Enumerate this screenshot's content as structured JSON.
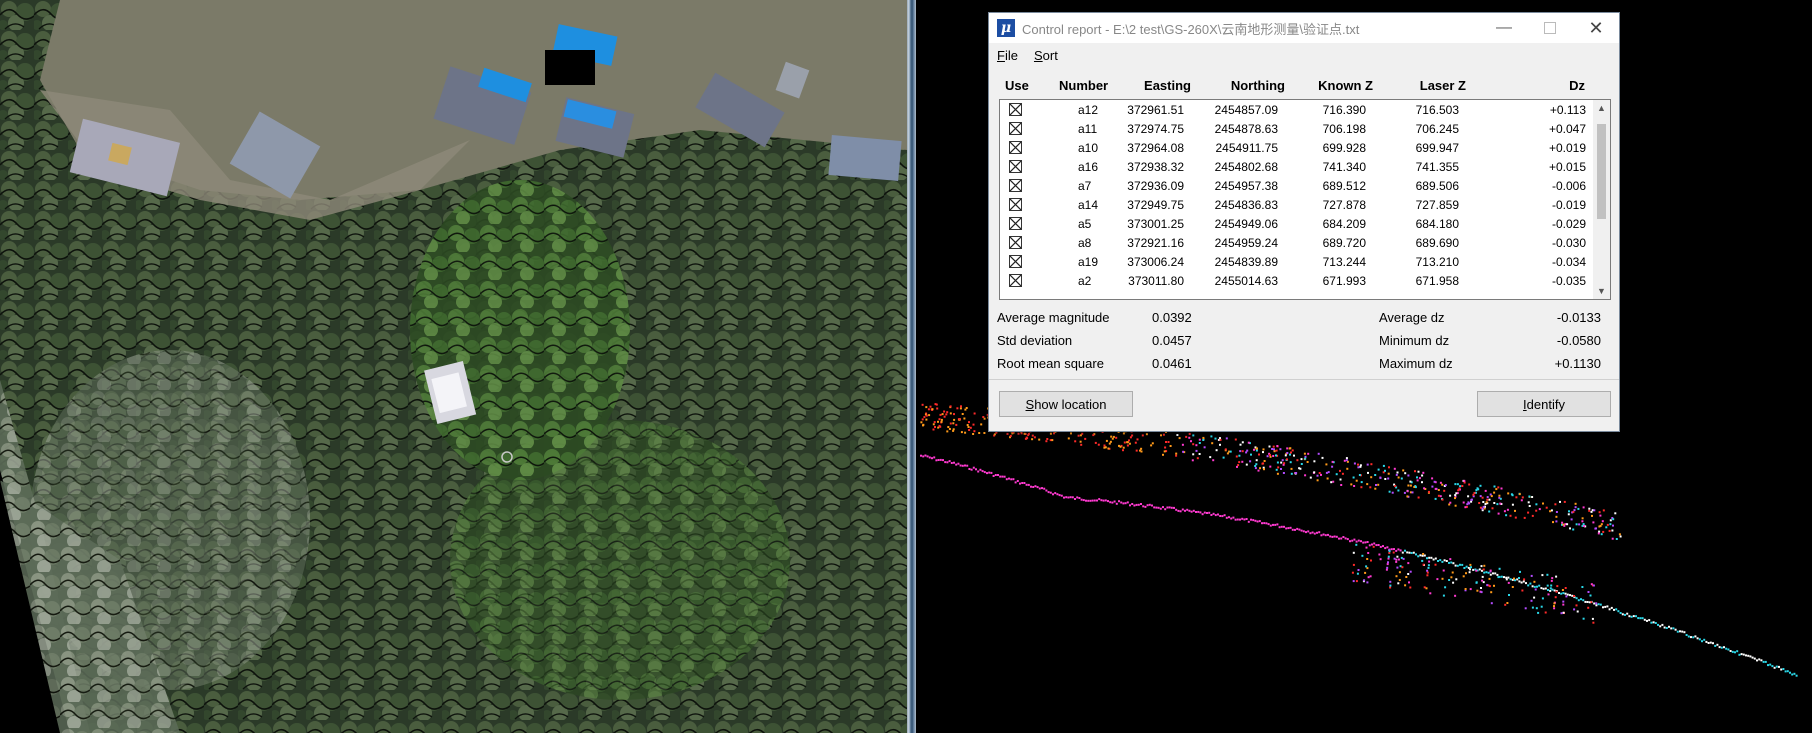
{
  "dialog": {
    "title": "Control report - E:\\2 test\\GS-260X\\云南地形测量\\验证点.txt",
    "app_icon_glyph": "μ",
    "menu": [
      {
        "label": "File",
        "hotkey": "F",
        "rest": "ile"
      },
      {
        "label": "Sort",
        "hotkey": "S",
        "rest": "ort"
      }
    ],
    "columns": {
      "use": "Use",
      "number": "Number",
      "easting": "Easting",
      "northing": "Northing",
      "known_z": "Known Z",
      "laser_z": "Laser Z",
      "dz": "Dz"
    },
    "rows": [
      {
        "number": "a12",
        "easting": "372961.51",
        "northing": "2454857.09",
        "known_z": "716.390",
        "laser_z": "716.503",
        "dz": "+0.113",
        "use": true
      },
      {
        "number": "a11",
        "easting": "372974.75",
        "northing": "2454878.63",
        "known_z": "706.198",
        "laser_z": "706.245",
        "dz": "+0.047",
        "use": true
      },
      {
        "number": "a10",
        "easting": "372964.08",
        "northing": "2454911.75",
        "known_z": "699.928",
        "laser_z": "699.947",
        "dz": "+0.019",
        "use": true
      },
      {
        "number": "a16",
        "easting": "372938.32",
        "northing": "2454802.68",
        "known_z": "741.340",
        "laser_z": "741.355",
        "dz": "+0.015",
        "use": true
      },
      {
        "number": "a7",
        "easting": "372936.09",
        "northing": "2454957.38",
        "known_z": "689.512",
        "laser_z": "689.506",
        "dz": "-0.006",
        "use": true
      },
      {
        "number": "a14",
        "easting": "372949.75",
        "northing": "2454836.83",
        "known_z": "727.878",
        "laser_z": "727.859",
        "dz": "-0.019",
        "use": true
      },
      {
        "number": "a5",
        "easting": "373001.25",
        "northing": "2454949.06",
        "known_z": "684.209",
        "laser_z": "684.180",
        "dz": "-0.029",
        "use": true
      },
      {
        "number": "a8",
        "easting": "372921.16",
        "northing": "2454959.24",
        "known_z": "689.720",
        "laser_z": "689.690",
        "dz": "-0.030",
        "use": true
      },
      {
        "number": "a19",
        "easting": "373006.24",
        "northing": "2454839.89",
        "known_z": "713.244",
        "laser_z": "713.210",
        "dz": "-0.034",
        "use": true
      },
      {
        "number": "a2",
        "easting": "373011.80",
        "northing": "2455014.63",
        "known_z": "671.993",
        "laser_z": "671.958",
        "dz": "-0.035",
        "use": true
      }
    ],
    "stats": {
      "average_magnitude_label": "Average magnitude",
      "average_magnitude": "0.0392",
      "std_deviation_label": "Std deviation",
      "std_deviation": "0.0457",
      "rms_label": "Root mean square",
      "rms": "0.0461",
      "average_dz_label": "Average dz",
      "average_dz": "-0.0133",
      "minimum_dz_label": "Minimum dz",
      "minimum_dz": "-0.0580",
      "maximum_dz_label": "Maximum dz",
      "maximum_dz": "+0.1130"
    },
    "buttons": {
      "show_location": {
        "hotkey": "S",
        "rest": "how location"
      },
      "identify": {
        "hotkey": "I",
        "rest": "dentify"
      }
    }
  },
  "colors": {
    "titlebar_bg": "#ffffff",
    "dialog_bg": "#f0f0f0",
    "app_icon": "#1d4ea3",
    "profile_points": [
      "#ff2a2a",
      "#ff3ad0",
      "#ff9a1a",
      "#ffffff",
      "#2ad8e8",
      "#b44cff"
    ]
  }
}
